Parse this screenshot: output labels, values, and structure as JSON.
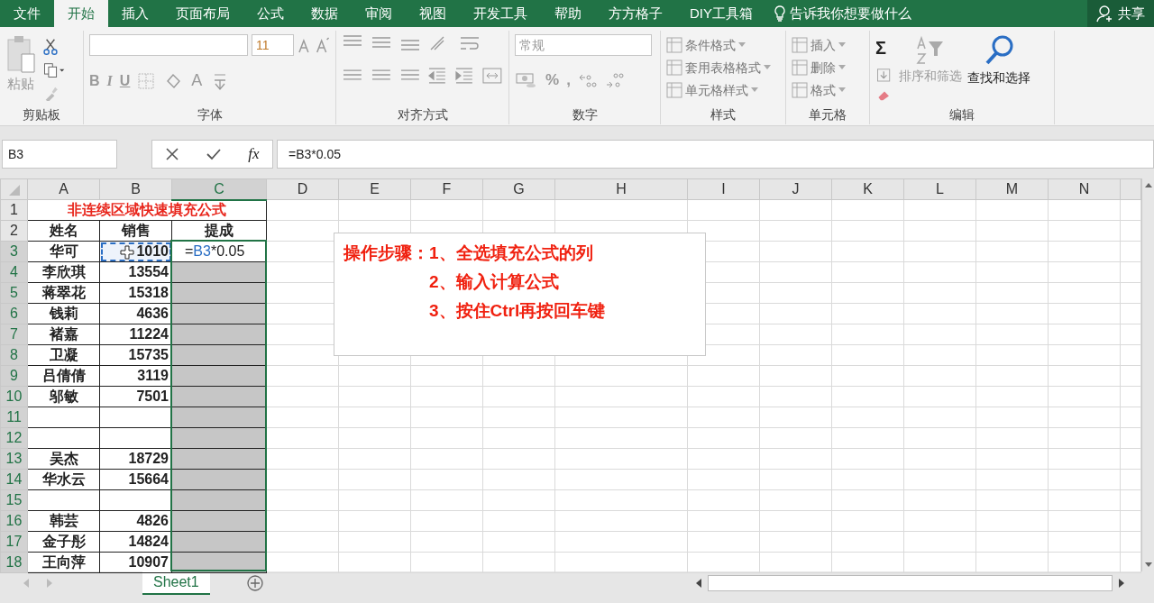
{
  "ribbon_tabs": [
    {
      "label": "文件",
      "selected": false
    },
    {
      "label": "开始",
      "selected": true
    },
    {
      "label": "插入",
      "selected": false
    },
    {
      "label": "页面布局",
      "selected": false
    },
    {
      "label": "公式",
      "selected": false
    },
    {
      "label": "数据",
      "selected": false
    },
    {
      "label": "审阅",
      "selected": false
    },
    {
      "label": "视图",
      "selected": false
    },
    {
      "label": "开发工具",
      "selected": false
    },
    {
      "label": "帮助",
      "selected": false
    },
    {
      "label": "方方格子",
      "selected": false
    },
    {
      "label": "DIY工具箱",
      "selected": false
    }
  ],
  "tell_me": "告诉我你想要做什么",
  "share": "共享",
  "ribbon": {
    "clipboard": {
      "paste": "粘贴",
      "label": "剪贴板"
    },
    "font": {
      "size": "11",
      "bold": "B",
      "italic": "I",
      "underline": "U",
      "font_color": "A",
      "label": "字体"
    },
    "alignment": {
      "label": "对齐方式"
    },
    "number": {
      "format": "常规",
      "percent": "%",
      "comma": ",",
      "label": "数字"
    },
    "styles": {
      "items": [
        "条件格式",
        "套用表格格式",
        "单元格样式"
      ],
      "label": "样式"
    },
    "cells": {
      "items": [
        "插入",
        "删除",
        "格式"
      ],
      "label": "单元格"
    },
    "editing": {
      "sum": "Σ",
      "sort": "排序和筛选",
      "find": "查找和选择",
      "label": "编辑"
    }
  },
  "name_box": "B3",
  "fx": "fx",
  "formula": "=B3*0.05",
  "columns": [
    {
      "label": "A",
      "selected": false
    },
    {
      "label": "B",
      "selected": false
    },
    {
      "label": "C",
      "selected": true
    },
    {
      "label": "D",
      "selected": false
    },
    {
      "label": "E",
      "selected": false
    },
    {
      "label": "F",
      "selected": false
    },
    {
      "label": "G",
      "selected": false
    },
    {
      "label": "H",
      "selected": false
    },
    {
      "label": "I",
      "selected": false
    },
    {
      "label": "J",
      "selected": false
    },
    {
      "label": "K",
      "selected": false
    },
    {
      "label": "L",
      "selected": false
    },
    {
      "label": "M",
      "selected": false
    },
    {
      "label": "N",
      "selected": false
    }
  ],
  "rows": [
    {
      "number": "1",
      "selected": false,
      "kind": "title",
      "title": "非连续区域快速填充公式"
    },
    {
      "number": "2",
      "selected": false,
      "kind": "header",
      "cells": [
        "姓名",
        "销售",
        "提成"
      ]
    },
    {
      "number": "3",
      "selected": true,
      "kind": "data",
      "name": "华可",
      "sales": "1010",
      "copied": true,
      "active": true,
      "commission": [
        {
          "text": "=",
          "kind": "plain"
        },
        {
          "text": "B3",
          "kind": "ref"
        },
        {
          "text": "*0.05",
          "kind": "plain"
        }
      ]
    },
    {
      "number": "4",
      "selected": true,
      "kind": "data",
      "name": "李欣琪",
      "sales": "13554",
      "copied": false,
      "active": false
    },
    {
      "number": "5",
      "selected": true,
      "kind": "data",
      "name": "蒋翠花",
      "sales": "15318",
      "copied": false,
      "active": false
    },
    {
      "number": "6",
      "selected": true,
      "kind": "data",
      "name": "钱莉",
      "sales": "4636",
      "copied": false,
      "active": false
    },
    {
      "number": "7",
      "selected": true,
      "kind": "data",
      "name": "褚嘉",
      "sales": "11224",
      "copied": false,
      "active": false
    },
    {
      "number": "8",
      "selected": true,
      "kind": "data",
      "name": "卫凝",
      "sales": "15735",
      "copied": false,
      "active": false
    },
    {
      "number": "9",
      "selected": true,
      "kind": "data",
      "name": "吕倩倩",
      "sales": "3119",
      "copied": false,
      "active": false
    },
    {
      "number": "10",
      "selected": true,
      "kind": "data",
      "name": "邬敏",
      "sales": "7501",
      "copied": false,
      "active": false
    },
    {
      "number": "11",
      "selected": true,
      "kind": "data",
      "copied": false,
      "active": false
    },
    {
      "number": "12",
      "selected": true,
      "kind": "data",
      "copied": false,
      "active": false
    },
    {
      "number": "13",
      "selected": true,
      "kind": "data",
      "name": "吴杰",
      "sales": "18729",
      "copied": false,
      "active": false
    },
    {
      "number": "14",
      "selected": true,
      "kind": "data",
      "name": "华水云",
      "sales": "15664",
      "copied": false,
      "active": false
    },
    {
      "number": "15",
      "selected": true,
      "kind": "data",
      "copied": false,
      "active": false
    },
    {
      "number": "16",
      "selected": true,
      "kind": "data",
      "name": "韩芸",
      "sales": "4826",
      "copied": false,
      "active": false
    },
    {
      "number": "17",
      "selected": true,
      "kind": "data",
      "name": "金子彤",
      "sales": "14824",
      "copied": false,
      "active": false
    },
    {
      "number": "18",
      "selected": true,
      "kind": "data",
      "name": "王向萍",
      "sales": "10907",
      "copied": false,
      "active": false
    }
  ],
  "text_box": {
    "lead": "操作步骤：",
    "lines": [
      "1、全选填充公式的列",
      "2、输入计算公式",
      "3、按住Ctrl再按回车键"
    ]
  },
  "sheet_tabs": [
    {
      "label": "Sheet1",
      "selected": true
    }
  ]
}
